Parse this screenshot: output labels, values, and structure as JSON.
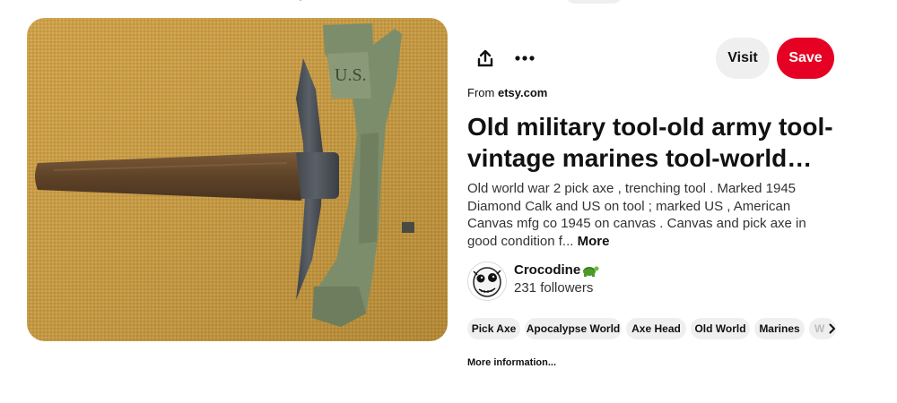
{
  "pin": {
    "source_prefix": "From",
    "source_domain": "etsy.com",
    "title": "Old military tool-old army tool-vintage marines tool-world wa...",
    "description": "Old world war 2 pick axe , trenching tool . Marked 1945 Diamond Calk and US on tool ; marked US , American Canvas mfg co 1945 on canvas . Canvas and pick axe in good condition f...",
    "description_more": "More",
    "image_stamp": "U.S."
  },
  "actions": {
    "share_icon": "share-icon",
    "more_icon": "more-options-icon",
    "visit_label": "Visit",
    "save_label": "Save",
    "save_color": "#e60023"
  },
  "creator": {
    "name": "Crocodine",
    "followers": "231 followers",
    "badge_icon": "turtle-icon"
  },
  "tags": [
    {
      "label": "Pick Axe"
    },
    {
      "label": "Apocalypse World"
    },
    {
      "label": "Axe Head"
    },
    {
      "label": "Old World"
    },
    {
      "label": "Marines"
    },
    {
      "label": "W"
    }
  ],
  "tags_next_icon": "chevron-right-icon",
  "more_information": "More information..."
}
